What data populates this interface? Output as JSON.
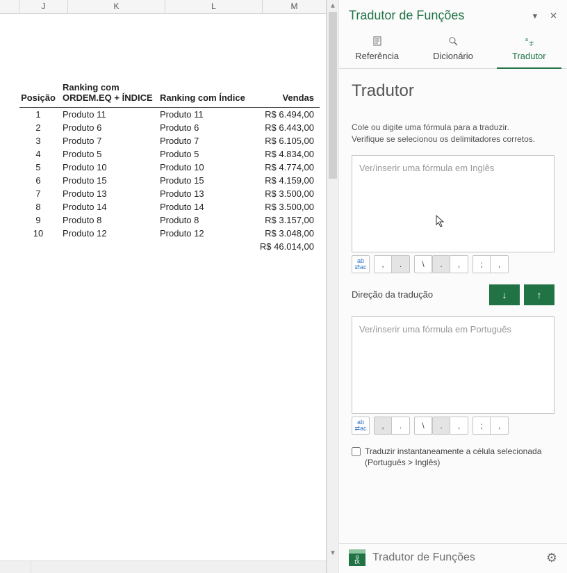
{
  "columns": {
    "J": "J",
    "K": "K",
    "L": "L",
    "M": "M"
  },
  "table": {
    "headers": {
      "posicao": "Posição",
      "ranking_eq": "Ranking com ORDEM.EQ + ÍNDICE",
      "ranking_idx": "Ranking com Índice",
      "vendas": "Vendas"
    },
    "rows": [
      {
        "pos": "1",
        "k": "Produto 11",
        "l": "Produto 11",
        "m": "R$ 6.494,00"
      },
      {
        "pos": "2",
        "k": "Produto 6",
        "l": "Produto 6",
        "m": "R$ 6.443,00"
      },
      {
        "pos": "3",
        "k": "Produto 7",
        "l": "Produto 7",
        "m": "R$ 6.105,00"
      },
      {
        "pos": "4",
        "k": "Produto 5",
        "l": "Produto 5",
        "m": "R$ 4.834,00"
      },
      {
        "pos": "5",
        "k": "Produto 10",
        "l": "Produto 10",
        "m": "R$ 4.774,00"
      },
      {
        "pos": "6",
        "k": "Produto 15",
        "l": "Produto 15",
        "m": "R$ 4.159,00"
      },
      {
        "pos": "7",
        "k": "Produto 13",
        "l": "Produto 13",
        "m": "R$ 3.500,00"
      },
      {
        "pos": "8",
        "k": "Produto 14",
        "l": "Produto 14",
        "m": "R$ 3.500,00"
      },
      {
        "pos": "9",
        "k": "Produto 8",
        "l": "Produto 8",
        "m": "R$ 3.157,00"
      },
      {
        "pos": "10",
        "k": "Produto 12",
        "l": "Produto 12",
        "m": "R$ 3.048,00"
      }
    ],
    "total": "R$ 46.014,00"
  },
  "pane": {
    "title": "Tradutor de Funções",
    "tabs": {
      "ref": "Referência",
      "dict": "Dicionário",
      "trans": "Tradutor"
    },
    "body_title": "Tradutor",
    "instruction1": "Cole ou digite uma fórmula para a traduzir.",
    "instruction2": "Verifique se selecionou os delimitadores corretos.",
    "placeholder_en": "Ver/inserir uma fórmula em Inglês",
    "placeholder_pt": "Ver/inserir uma fórmula em Português",
    "direction_label": "Direção da tradução",
    "instant_label": "Traduzir instantaneamente a célula selecionada (Português > Inglês)",
    "buttons": {
      "abac": "ab⇄ac",
      "comma": ",",
      "period": ".",
      "backslash": "\\",
      "semicolon": ";"
    },
    "footer_title": "Tradutor de Funções"
  },
  "icons": {
    "dropdown": "▾",
    "close": "✕",
    "gear": "⚙",
    "arrow_down": "↓",
    "arrow_up": "↑",
    "scroll_up": "▲",
    "scroll_down": "▼"
  }
}
